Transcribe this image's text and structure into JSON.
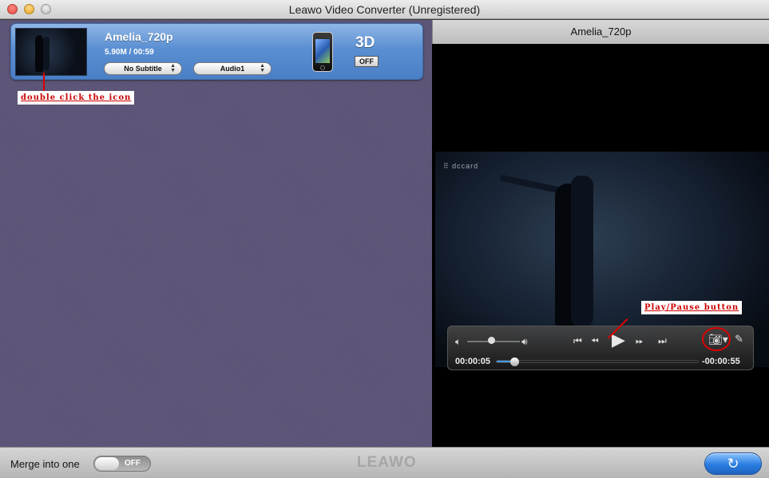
{
  "window": {
    "title": "Leawo Video Converter (Unregistered)"
  },
  "file": {
    "name": "Amelia_720p",
    "meta": "5.90M / 00:59",
    "subtitle": "No Subtitle",
    "audio": "Audio1",
    "device_icon": "iphone-icon",
    "three_d_label": "3D",
    "three_d_state": "OFF"
  },
  "annotations": {
    "icon_hint": "double click the icon",
    "play_hint": "Play/Pause button"
  },
  "preview": {
    "title": "Amelia_720p",
    "watermark": "⠿ dccard",
    "time_current": "00:00:05",
    "time_remaining": "-00:00:55",
    "progress": 0.08,
    "volume": 0.45,
    "icons": {
      "volume_low": "volume-low-icon",
      "volume_high": "volume-high-icon",
      "prev": "previous-chapter-icon",
      "rewind": "rewind-icon",
      "play": "play-icon",
      "forward": "fast-forward-icon",
      "next": "next-chapter-icon",
      "snapshot": "camera-icon",
      "edit": "edit-icon"
    }
  },
  "bottom": {
    "merge_label": "Merge into one",
    "merge_state": "OFF",
    "logo": "LEAWO"
  },
  "colors": {
    "panel_bg": "#5c5578",
    "card_blue": "#5a8fd2",
    "annotation_red": "#cc0000",
    "seek_blue": "#4b9be8"
  }
}
